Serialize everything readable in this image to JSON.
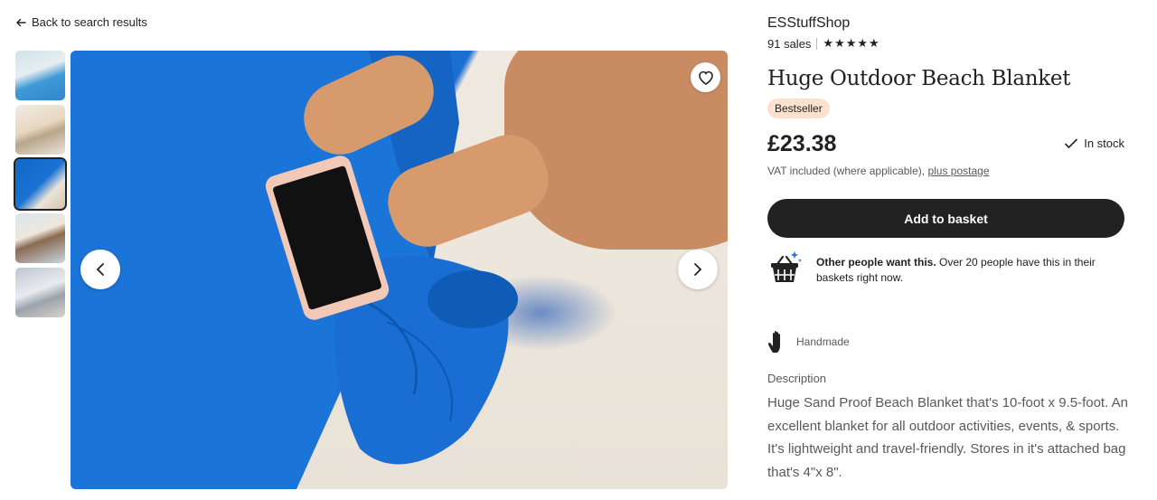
{
  "nav": {
    "back_label": "Back to search results"
  },
  "gallery": {
    "thumbnails": [
      {
        "name": "thumbnail-1",
        "active": false
      },
      {
        "name": "thumbnail-2",
        "active": false
      },
      {
        "name": "thumbnail-3",
        "active": true
      },
      {
        "name": "thumbnail-4",
        "active": false
      },
      {
        "name": "thumbnail-5",
        "active": false
      }
    ]
  },
  "product": {
    "shop_name": "ESStuffShop",
    "sales": "91 sales",
    "stars": "★★★★★",
    "rating": 5,
    "title": "Huge Outdoor Beach Blanket",
    "badge": "Bestseller",
    "price": "£23.38",
    "stock": "In stock",
    "vat_text": "VAT included (where applicable),",
    "postage_link": "plus postage",
    "add_to_basket": "Add to basket",
    "demand_bold": "Other people want this.",
    "demand_text": "Over 20 people have this in their baskets right now.",
    "handmade": "Handmade",
    "description_label": "Description",
    "description": "Huge Sand Proof Beach Blanket that's 10-foot x 9.5-foot. An excellent blanket for all outdoor activities, events, & sports. It's lightweight and travel-friendly. Stores in it's attached bag that's 4\"x 8\"."
  },
  "colors": {
    "primary": "#222222",
    "badge_bg": "#fde1cf",
    "muted_text": "#595959",
    "blanket_blue": "#1973d6"
  }
}
